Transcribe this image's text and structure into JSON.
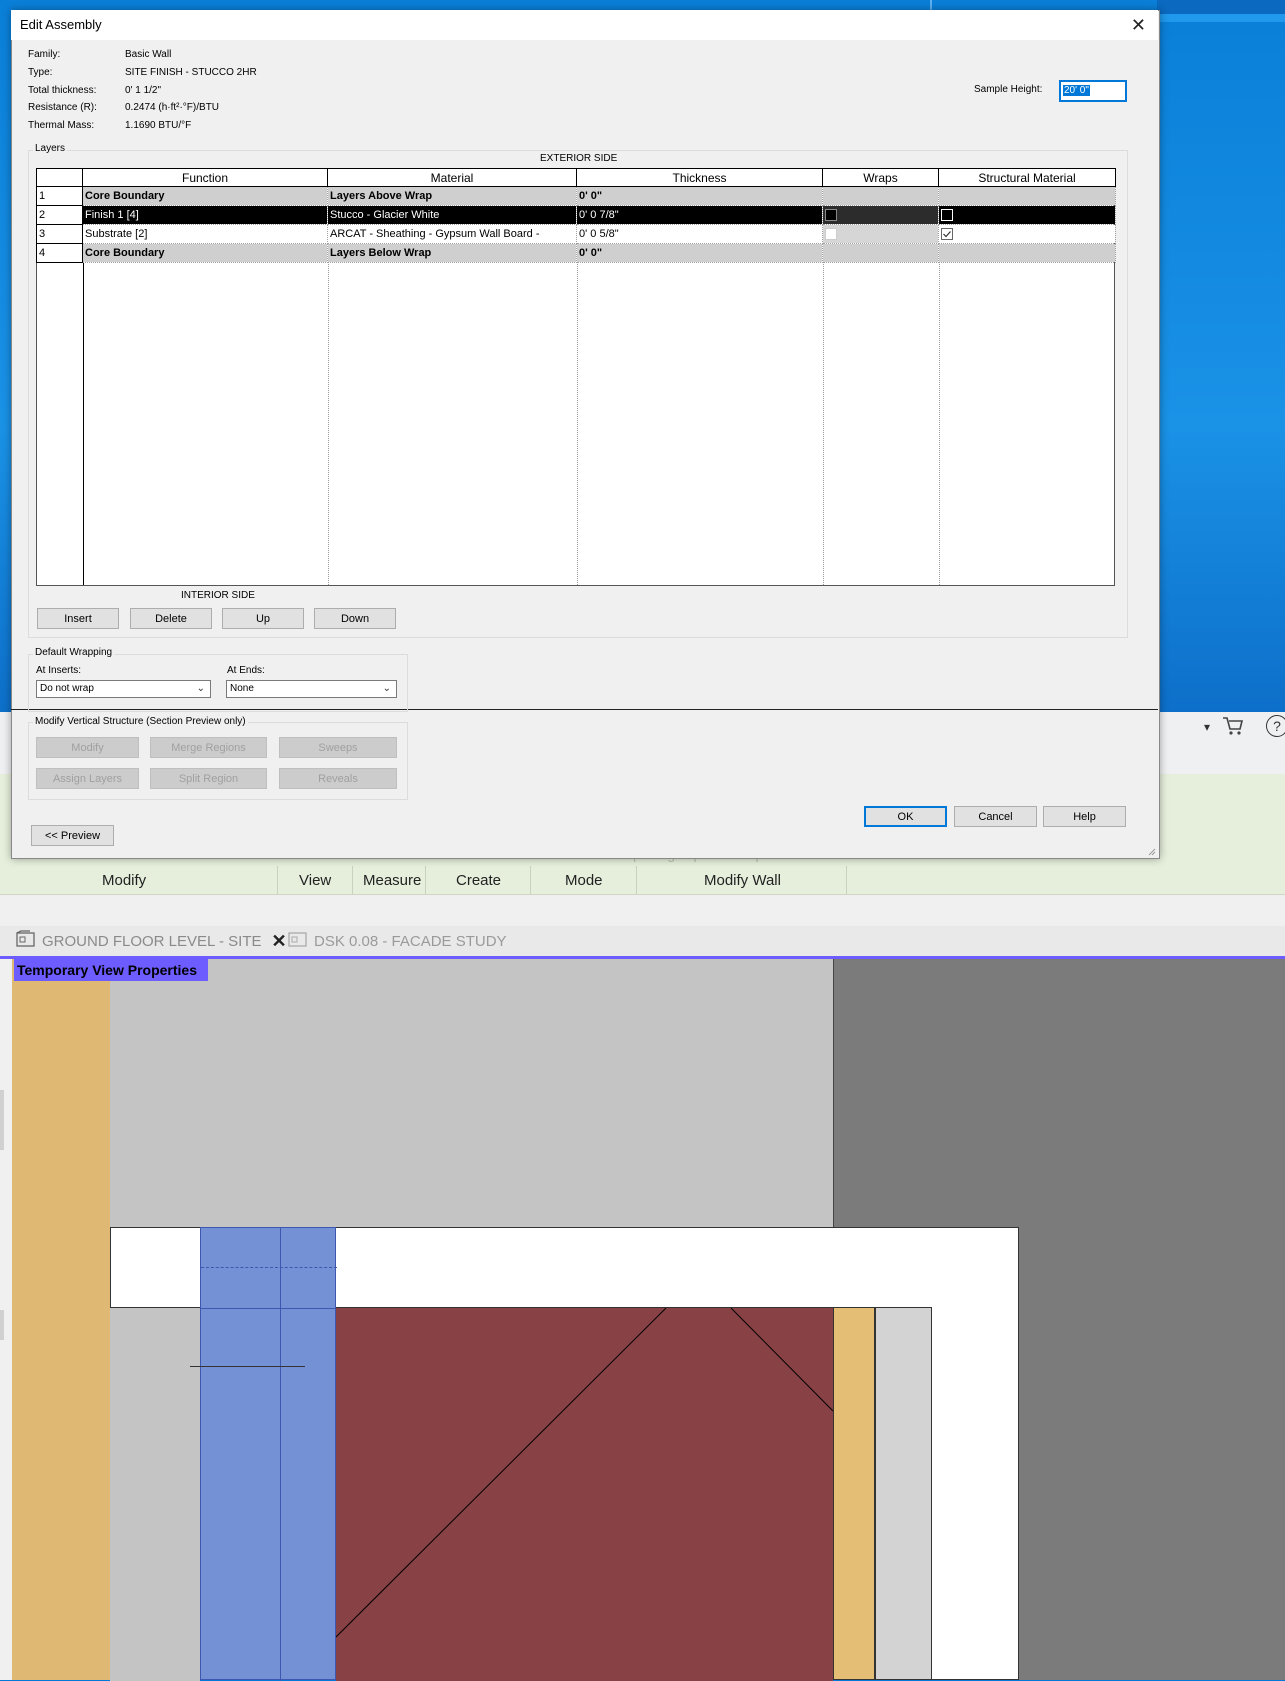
{
  "dialog": {
    "title": "Edit Assembly",
    "close_label": "✕",
    "info": {
      "family_label": "Family:",
      "family_value": "Basic Wall",
      "type_label": "Type:",
      "type_value": "SITE FINISH - STUCCO 2HR",
      "thickness_label": "Total thickness:",
      "thickness_value": "0'  1 1/2\"",
      "resistance_label": "Resistance (R):",
      "resistance_value": "0.2474 (h·ft²·°F)/BTU",
      "mass_label": "Thermal Mass:",
      "mass_value": "1.1690 BTU/°F"
    },
    "sample_height_label": "Sample Height:",
    "sample_height_value": "20'  0\"",
    "layers": {
      "group_label": "Layers",
      "exterior_label": "EXTERIOR SIDE",
      "interior_label": "INTERIOR SIDE",
      "columns": [
        "Function",
        "Material",
        "Thickness",
        "Wraps",
        "Structural Material"
      ],
      "rows": [
        {
          "num": "1",
          "function": "Core Boundary",
          "material": "Layers Above Wrap",
          "thickness": "0'  0\""
        },
        {
          "num": "2",
          "function": "Finish 1 [4]",
          "material": "Stucco - Glacier White",
          "thickness": "0'  0 7/8\""
        },
        {
          "num": "3",
          "function": "Substrate [2]",
          "material": "ARCAT - Sheathing - Gypsum Wall Board -",
          "thickness": "0'  0 5/8\""
        },
        {
          "num": "4",
          "function": "Core Boundary",
          "material": "Layers Below Wrap",
          "thickness": "0'  0\""
        }
      ],
      "buttons": {
        "insert": "Insert",
        "delete": "Delete",
        "up": "Up",
        "down": "Down"
      }
    },
    "wrapping": {
      "group_label": "Default Wrapping",
      "inserts_label": "At Inserts:",
      "inserts_value": "Do not wrap",
      "ends_label": "At  Ends:",
      "ends_value": "None"
    },
    "vertical": {
      "group_label": "Modify Vertical Structure (Section Preview only)",
      "modify": "Modify",
      "merge": "Merge Regions",
      "sweeps": "Sweeps",
      "assign": "Assign Layers",
      "split": "Split Region",
      "reveals": "Reveals"
    },
    "preview_label": "<< Preview",
    "ok_label": "OK",
    "cancel_label": "Cancel",
    "help_label": "Help"
  },
  "ribbon": {
    "labels": {
      "modify": "Modify",
      "view": "View",
      "measure": "Measure",
      "create": "Create",
      "mode": "Mode",
      "modify_wall": "Modify Wall"
    },
    "ghost_text": "Profile  Profile    Opening   Top/Base   Top/Base"
  },
  "view_tabs": {
    "active": "GROUND FLOOR LEVEL - SITE",
    "inactive": "DSK 0.08 - FACADE STUDY",
    "close_label": "✕"
  },
  "temp_view_label": "Temporary View Properties",
  "colors": {
    "accent": "#0078d7",
    "tab_underline": "#6d5cff",
    "wood": "#dfb974",
    "blue_column": "#7591d6",
    "brick_red": "#884145",
    "light_gray": "#c4c4c4"
  }
}
